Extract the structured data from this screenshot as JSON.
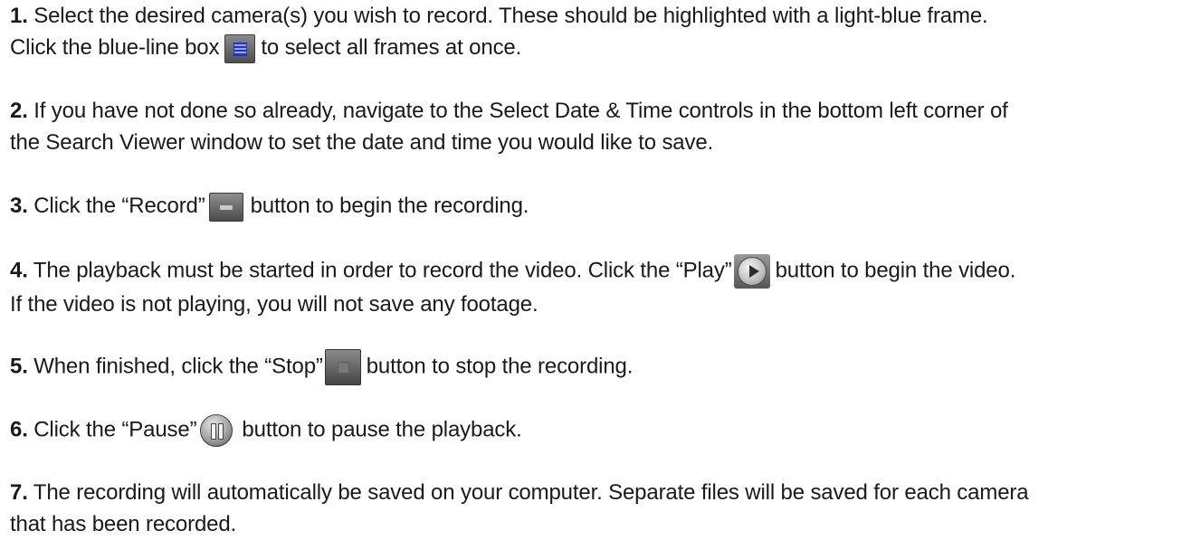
{
  "steps": [
    {
      "number": "1.",
      "line1_text": " Select the desired camera(s) you wish to record. These should be highlighted with a light-blue frame.",
      "line2_before": "Click the blue-line box",
      "icon": "select-all-grid-icon",
      "line2_after": "to select all frames at once."
    },
    {
      "number": "2.",
      "line1_text": " If you have not done so already, navigate to the Select Date & Time controls in the bottom left corner of",
      "line2_text": "the Search Viewer window to set the date and time you would like to save."
    },
    {
      "number": "3.",
      "before": " Click the “Record”",
      "icon": "record-icon",
      "after": "button to begin the recording."
    },
    {
      "number": "4.",
      "line1_before": " The playback must be started in order to record the video. Click the “Play”",
      "icon": "play-icon",
      "line1_after": "button to begin the video.",
      "line2_text": "If the video is not playing, you will not save any footage."
    },
    {
      "number": "5.",
      "before": " When finished, click the “Stop”",
      "icon": "stop-icon",
      "after": "button to stop the recording."
    },
    {
      "number": "6.",
      "before": " Click the “Pause”",
      "icon": "pause-icon",
      "after": "button to pause the playback."
    },
    {
      "number": "7.",
      "line1_text": " The recording will automatically be saved on your computer. Separate files will be saved for each camera",
      "line2_text": "that has been recorded."
    }
  ]
}
